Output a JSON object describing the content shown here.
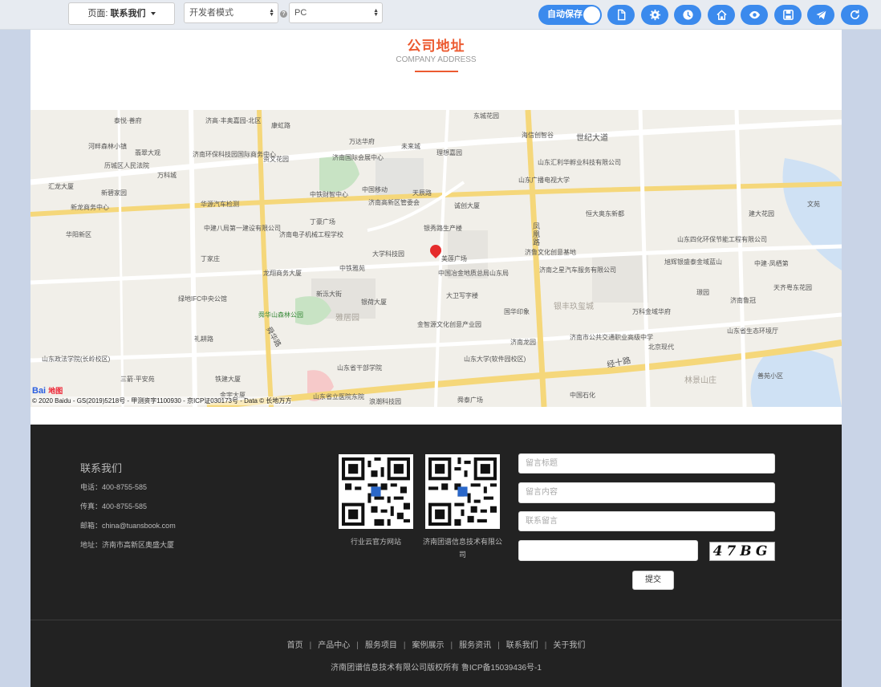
{
  "toolbar": {
    "page_prefix": "页面:",
    "page_name": "联系我们",
    "mode": "开发者模式",
    "device": "PC",
    "autosave_label": "自动保存"
  },
  "section": {
    "title": "公司地址",
    "subtitle": "COMPANY ADDRESS"
  },
  "map": {
    "labels": [
      "泰悦·善府",
      "济高·丰奥嘉园-北区",
      "康虹路",
      "万达华府",
      "未来城",
      "理想嘉园",
      "东城花园",
      "海信创智谷",
      "世纪大道",
      "山东汇利华孵业科技有限公司",
      "河畔森林小镇",
      "翡翠大观",
      "历城区人民法院",
      "万科城",
      "济南环保科技园国际商务中心",
      "资文花园",
      "济南国际会展中心",
      "中国移动",
      "济南高新区管委会",
      "天辰路",
      "诚创大厦",
      "山东广播电视大学",
      "恒大奥东新都",
      "建大花园",
      "文苑",
      "汇龙大厦",
      "新碧家园",
      "新龙商务中心",
      "华源汽车检测",
      "中铁财智中心",
      "丁豪广场",
      "银秀路生产楼",
      "华阳新区",
      "中建八局第一建设有限公司",
      "济南电子机械工程学校",
      "丁家庄",
      "大学科技园",
      "美莲广场",
      "济鲁文化创意基地",
      "山东四化环保节能工程有限公司",
      "旭辉银盛泰金域蓝山",
      "中建·凤栖第",
      "龙翔商务大厦",
      "中铁雅苑",
      "中国冶金地质总局山东局",
      "济南之星汽车服务有限公司",
      "璟园",
      "天齐粤东花园",
      "绿地IFC中央公馆",
      "新泺大街",
      "银荷大厦",
      "大卫写字楼",
      "国华印象",
      "银丰玖玺城",
      "万科金域华府",
      "济南鲁冠",
      "舜华山森林公园",
      "雅居园",
      "金智源文化创意产业园",
      "济南市公共交通职业高级中学",
      "山东省生态环境厅",
      "礼耕路",
      "舜华路",
      "济南龙园",
      "北京现代",
      "山东政法学院(长岭校区)",
      "三箭·平安苑",
      "铁建大厦",
      "山东省干部学院",
      "山东大学(软件园校区)",
      "经十路",
      "林景山庄",
      "善苑小区",
      "中国石化",
      "金宇大厦",
      "浪潮科技园",
      "舜泰广场",
      "山东省立医院东院",
      "凤凰路"
    ],
    "copyright": "© 2020 Baidu - GS(2019)5218号 - 甲测资字1100930 - 京ICP证030173号 - Data © 长地万方",
    "logo": "Bai",
    "logo2": "地图"
  },
  "footer": {
    "contact_title": "联系我们",
    "phone": "电话：400-8755-585",
    "fax": "传真：400-8755-585",
    "email": "邮箱：china@tuansbook.com",
    "address": "地址：济南市高新区奥盛大厦",
    "qr1_caption": "行业云官方网站",
    "qr2_caption": "济南团谱信息技术有限公司",
    "form": {
      "title_placeholder": "留言标题",
      "content_placeholder": "留言内容",
      "contact_placeholder": "联系留言",
      "captcha_text": "47BG",
      "submit_label": "提交"
    },
    "nav": [
      "首页",
      "产品中心",
      "服务项目",
      "案例展示",
      "服务资讯",
      "联系我们",
      "关于我们"
    ],
    "copyright": "济南团谱信息技术有限公司版权所有 鲁ICP备15039436号-1"
  },
  "colors": {
    "accent": "#ec5a30",
    "toolbar_button": "#3b8aed",
    "footer_bg": "#222222",
    "page_bg": "#c9d4e7"
  },
  "icons": {
    "toolbar": [
      "file-icon",
      "settings-icon",
      "clock-icon",
      "home-icon",
      "eye-icon",
      "save-icon",
      "send-icon",
      "refresh-icon"
    ]
  }
}
